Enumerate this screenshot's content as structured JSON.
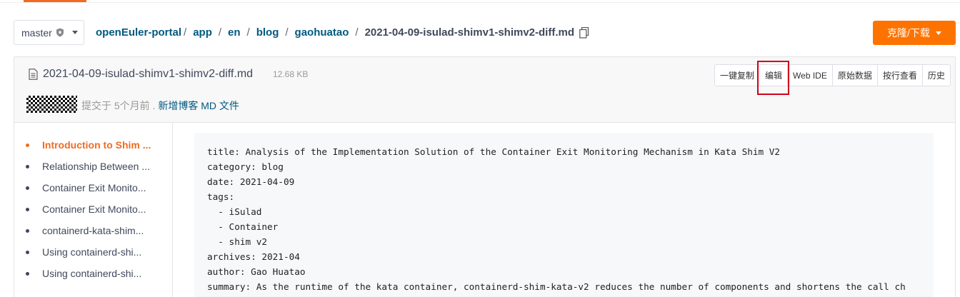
{
  "branch": {
    "label": "master"
  },
  "breadcrumb": {
    "items": [
      "openEuler-portal",
      "app",
      "en",
      "blog",
      "gaohuatao"
    ],
    "current": "2021-04-09-isulad-shimv1-shimv2-diff.md"
  },
  "clone_button": {
    "label": "克隆/下载"
  },
  "file": {
    "name": "2021-04-09-isulad-shimv1-shimv2-diff.md",
    "size": "12.68 KB"
  },
  "actions": [
    "一键复制",
    "编辑",
    "Web IDE",
    "原始数据",
    "按行查看",
    "历史"
  ],
  "commit": {
    "time_text": "提交于 5个月前 .",
    "message": "新增博客 MD 文件"
  },
  "toc": {
    "items": [
      "Introduction to Shim ...",
      "Relationship Between ...",
      "Container Exit Monito...",
      "Container Exit Monito...",
      "containerd-kata-shim...",
      "Using containerd-shi...",
      "Using containerd-shi..."
    ]
  },
  "code": {
    "lines": [
      "title: Analysis of the Implementation Solution of the Container Exit Monitoring Mechanism in Kata Shim V2",
      "category: blog",
      "date: 2021-04-09",
      "tags:",
      "  - iSulad",
      "  - Container",
      "  - shim v2",
      "archives: 2021-04",
      "author: Gao Huatao",
      "summary: As the runtime of the kata container, containerd-shim-kata-v2 reduces the number of components and shortens the call ch"
    ]
  },
  "colors": {
    "accent": "#f06b22",
    "clone_button": "#fe7300",
    "link": "#005980",
    "highlight_box": "#d0021b"
  },
  "icons": {
    "branch_protect": "shield-icon",
    "copy": "copy-icon",
    "file": "file-icon",
    "dropdown": "caret-down-icon"
  }
}
